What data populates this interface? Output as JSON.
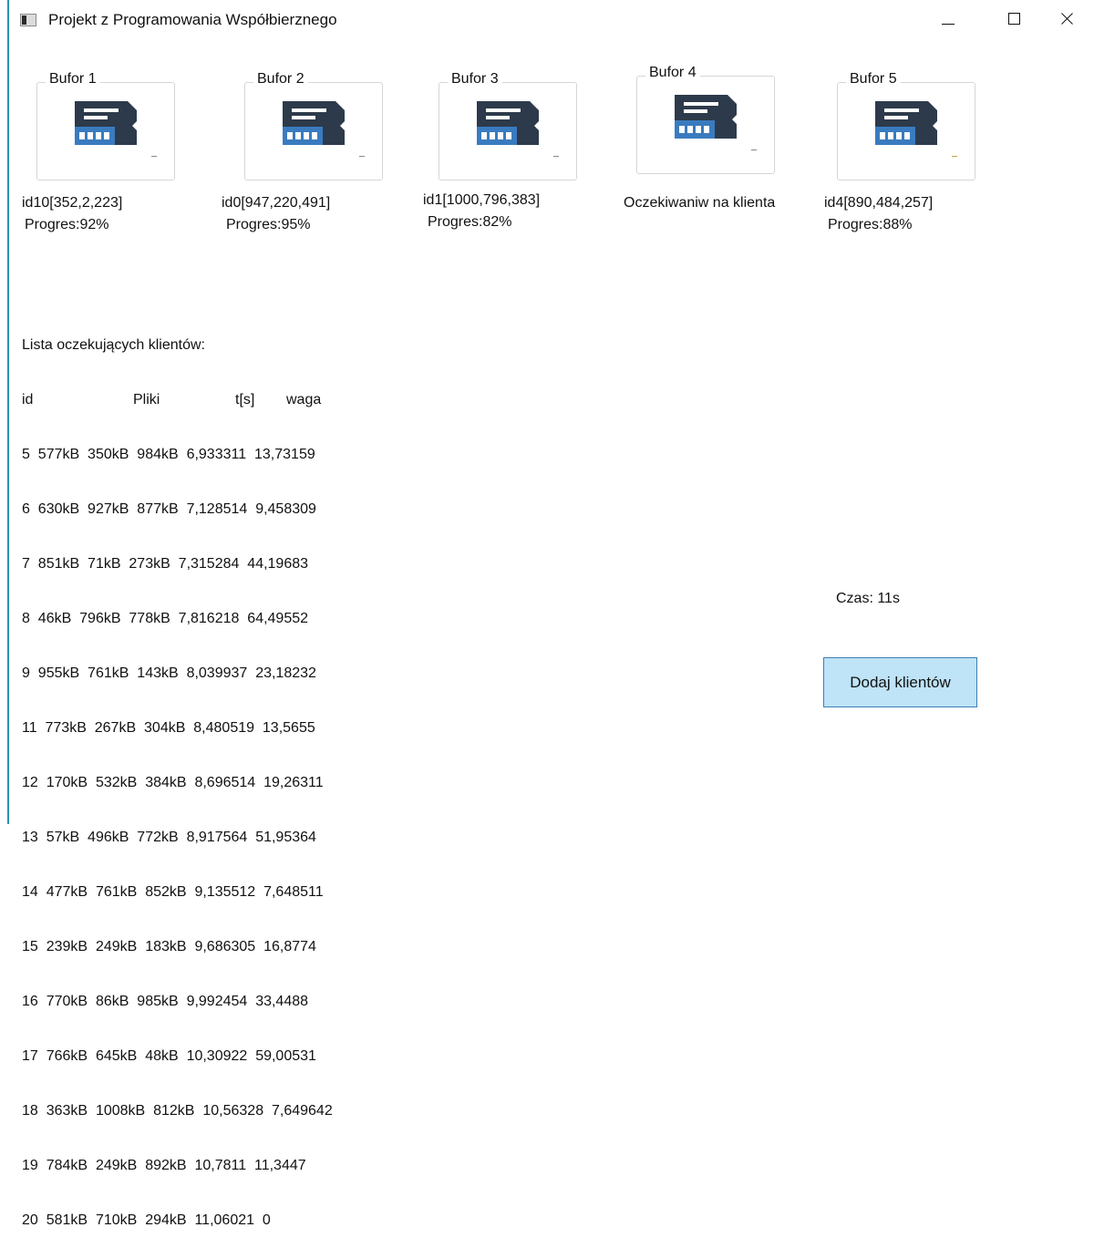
{
  "window": {
    "title": "Projekt z Programowania Współbierznego"
  },
  "buffers": [
    {
      "label": "Bufor 1",
      "info": "id10[352,2,223]",
      "progress": "Progres:92%"
    },
    {
      "label": "Bufor 2",
      "info": "id0[947,220,491]",
      "progress": "Progres:95%"
    },
    {
      "label": "Bufor 3",
      "info": "id1[1000,796,383]",
      "progress": "Progres:82%"
    },
    {
      "label": "Bufor 4",
      "info": "Oczekiwaniw na klienta",
      "progress": ""
    },
    {
      "label": "Bufor 5",
      "info": "id4[890,484,257]",
      "progress": "Progres:88%"
    }
  ],
  "queue": {
    "title": "Lista oczekujących klientów:",
    "headers": [
      "id",
      "Pliki",
      "t[s]",
      "waga"
    ],
    "rows": [
      "5  577kB  350kB  984kB  6,933311  13,73159",
      "6  630kB  927kB  877kB  7,128514  9,458309",
      "7  851kB  71kB  273kB  7,315284  44,19683",
      "8  46kB  796kB  778kB  7,816218  64,49552",
      "9  955kB  761kB  143kB  8,039937  23,18232",
      "11  773kB  267kB  304kB  8,480519  13,5655",
      "12  170kB  532kB  384kB  8,696514  19,26311",
      "13  57kB  496kB  772kB  8,917564  51,95364",
      "14  477kB  761kB  852kB  9,135512  7,648511",
      "15  239kB  249kB  183kB  9,686305  16,8774",
      "16  770kB  86kB  985kB  9,992454  33,4488",
      "17  766kB  645kB  48kB  10,30922  59,00531",
      "18  363kB  1008kB  812kB  10,56328  7,649642",
      "19  784kB  249kB  892kB  10,7811  11,3447",
      "20  581kB  710kB  294kB  11,06021  0"
    ]
  },
  "timer": "Czas: 11s",
  "add_button": "Dodaj klientów",
  "colors": {
    "icon_dark": "#2d3a4b",
    "icon_blue": "#3a7bbf",
    "button_bg": "#bfe3f7",
    "button_border": "#3c7fb1",
    "accent": "#2a93b8"
  }
}
